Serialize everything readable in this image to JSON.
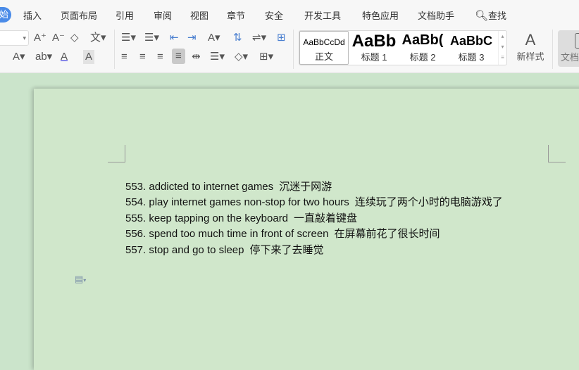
{
  "tabs": [
    "开始",
    "插入",
    "页面布局",
    "引用",
    "审阅",
    "视图",
    "章节",
    "安全",
    "开发工具",
    "特色应用",
    "文档助手",
    "查找"
  ],
  "styles": [
    {
      "preview": "AaBbCcDd",
      "label": "正文"
    },
    {
      "preview": "AaBb",
      "label": "标题 1"
    },
    {
      "preview": "AaBb(",
      "label": "标题 2"
    },
    {
      "preview": "AaBbC",
      "label": "标题 3"
    }
  ],
  "new_style": "新样式",
  "doc_button": "文档",
  "lines": [
    {
      "num": "553.",
      "en": "addicted to internet games",
      "cn": "沉迷于网游"
    },
    {
      "num": "554.",
      "en": "play internet games non-stop for two hours",
      "cn": "连续玩了两个小时的电脑游戏了"
    },
    {
      "num": "555.",
      "en": "keep tapping on the keyboard",
      "cn": "一直敲着键盘"
    },
    {
      "num": "556.",
      "en": "spend too much time in front of screen",
      "cn": "在屏幕前花了很长时间"
    },
    {
      "num": "557.",
      "en": "stop and go to sleep",
      "cn": "停下来了去睡觉"
    }
  ]
}
